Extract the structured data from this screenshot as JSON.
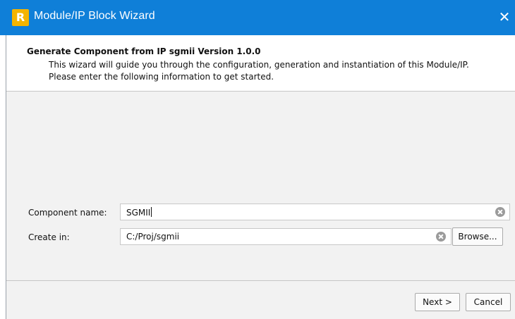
{
  "window": {
    "title": "Module/IP Block Wizard",
    "icon": "app-logo-icon",
    "icon_letter": "R",
    "close_glyph": "✕",
    "titlebar_color": "#0f7fd8"
  },
  "header": {
    "title": "Generate Component from IP sgmii Version 1.0.0",
    "description_line1": "This wizard will guide you through the configuration, generation and instantiation of this Module/IP.",
    "description_line2": "Please enter the following information to get started."
  },
  "form": {
    "component_name": {
      "label": "Component name:",
      "value": "SGMII"
    },
    "create_in": {
      "label": "Create in:",
      "value": "C:/Proj/sgmii",
      "browse_label": "Browse..."
    }
  },
  "footer": {
    "next_label": "Next >",
    "cancel_label": "Cancel"
  }
}
